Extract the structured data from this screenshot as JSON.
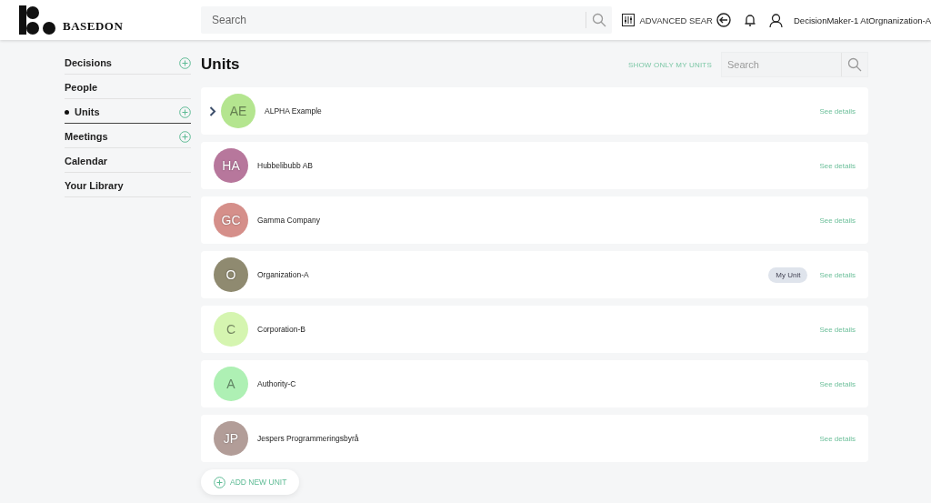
{
  "header": {
    "brand": "BASEDON",
    "search": {
      "placeholder": "Search"
    },
    "advanced_search": "ADVANCED SEAR",
    "user": "DecisionMaker-1 AtOrgnanization-A"
  },
  "sidebar": {
    "items": [
      {
        "label": "Decisions",
        "selected": false,
        "has_add": true
      },
      {
        "label": "People",
        "selected": false,
        "has_add": false
      },
      {
        "label": "Units",
        "selected": true,
        "has_add": true
      },
      {
        "label": "Meetings",
        "selected": false,
        "has_add": true
      },
      {
        "label": "Calendar",
        "selected": false,
        "has_add": false
      },
      {
        "label": "Your Library",
        "selected": false,
        "has_add": false
      }
    ]
  },
  "page": {
    "title": "Units",
    "filter": "SHOW ONLY MY UNITS",
    "search": {
      "placeholder": "Search"
    }
  },
  "units": [
    {
      "initials": "AE",
      "name": "ALPHA Example",
      "color": "#b4e58f",
      "expandable": true,
      "link": "See details"
    },
    {
      "initials": "HA",
      "name": "Hubbelibubb AB",
      "color": "#b7779c",
      "expandable": false,
      "link": "See details"
    },
    {
      "initials": "GC",
      "name": "Gamma Company",
      "color": "#d58f8a",
      "expandable": false,
      "link": "See details"
    },
    {
      "initials": "O",
      "name": "Organization-A",
      "color": "#8f8a70",
      "expandable": false,
      "badge": "My Unit",
      "link": "See details"
    },
    {
      "initials": "C",
      "name": "Corporation-B",
      "color": "#d5f5b0",
      "expandable": false,
      "link": "See details"
    },
    {
      "initials": "A",
      "name": "Authority-C",
      "color": "#aef0b4",
      "expandable": false,
      "link": "See details"
    },
    {
      "initials": "JP",
      "name": "Jespers Programmeringsbyrå",
      "color": "#b29d98",
      "expandable": false,
      "link": "See details"
    }
  ],
  "add_button": "ADD NEW UNIT"
}
